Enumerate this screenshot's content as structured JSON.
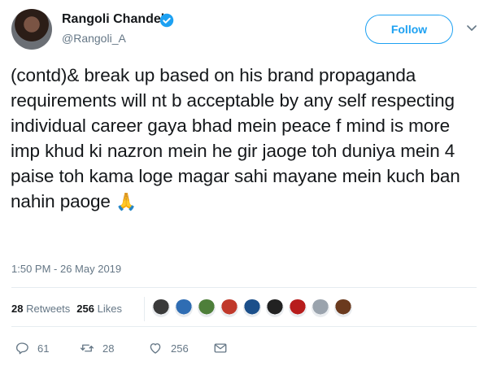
{
  "user": {
    "name": "Rangoli Chandel",
    "handle": "@Rangoli_A"
  },
  "follow_label": "Follow",
  "tweet": {
    "text": "(contd)& break up based on his brand propaganda requirements will nt b acceptable by any self respecting individual career gaya bhad mein peace f mind is more imp khud ki nazron mein he gir jaoge toh duniya mein 4 paise toh kama loge magar sahi mayane mein kuch ban nahin paoge",
    "emoji": "🙏",
    "timestamp": "1:50 PM - 26 May 2019"
  },
  "stats": {
    "retweets_count": "28",
    "retweets_label": "Retweets",
    "likes_count": "256",
    "likes_label": "Likes"
  },
  "liker_avatar_colors": [
    "#3a3a3a",
    "#2f6db3",
    "#4e7f3a",
    "#c0392b",
    "#1b4f8a",
    "#222222",
    "#b71c1c",
    "#9aa3ad",
    "#6b3a1e"
  ],
  "actions": {
    "replies": "61",
    "retweets": "28",
    "likes": "256"
  },
  "colors": {
    "accent": "#1da1f2",
    "text": "#14171a",
    "secondary": "#657786",
    "emoji": "#f2b134"
  }
}
